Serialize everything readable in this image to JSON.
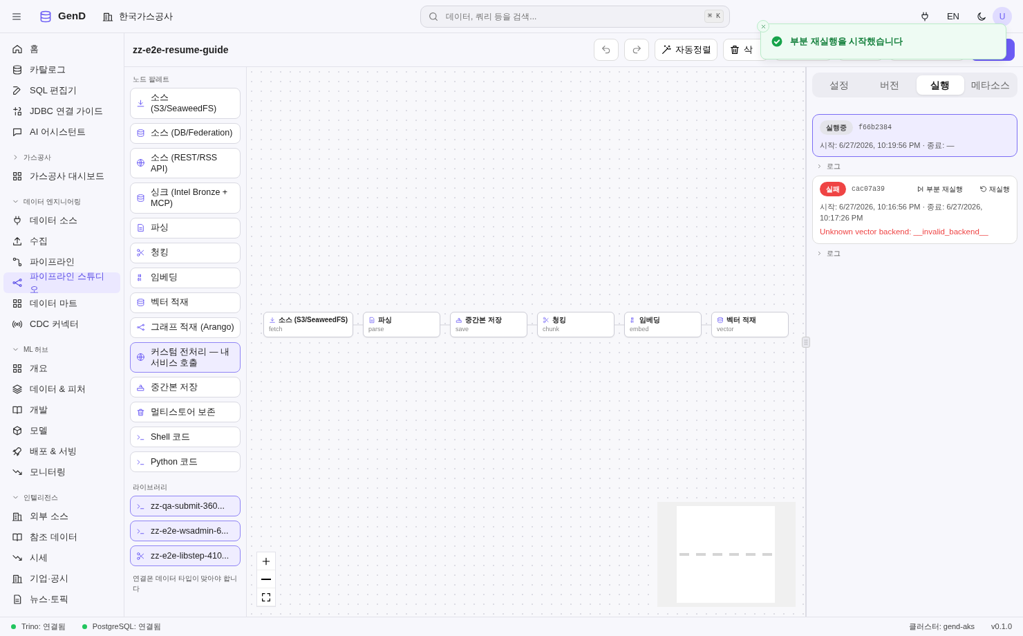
{
  "topbar": {
    "brand": "GenD",
    "org": "한국가스공사",
    "search": {
      "placeholder": "데이터, 쿼리 등을 검색...",
      "shortcut": "⌘ K"
    },
    "language": "EN",
    "avatar": "U"
  },
  "sidebar": {
    "items": [
      {
        "label": "홈",
        "selected": false
      },
      {
        "label": "카탈로그",
        "selected": false
      },
      {
        "label": "SQL 편집기",
        "selected": false
      },
      {
        "label": "JDBC 연결 가이드",
        "selected": false
      },
      {
        "label": "AI 어시스턴트",
        "selected": false
      }
    ],
    "groups": [
      {
        "title": "가스공사",
        "expanded": false,
        "items": [
          {
            "label": "가스공사 대시보드",
            "selected": false
          }
        ]
      },
      {
        "title": "데이터 엔지니어링",
        "expanded": true,
        "items": [
          {
            "label": "데이터 소스",
            "selected": false
          },
          {
            "label": "수집",
            "selected": false
          },
          {
            "label": "파이프라인",
            "selected": false
          },
          {
            "label": "파이프라인 스튜디오",
            "selected": true
          },
          {
            "label": "데이터 마트",
            "selected": false
          },
          {
            "label": "CDC 커넥터",
            "selected": false
          }
        ]
      },
      {
        "title": "ML 허브",
        "expanded": true,
        "items": [
          {
            "label": "개요",
            "selected": false
          },
          {
            "label": "데이터 & 피처",
            "selected": false
          },
          {
            "label": "개발",
            "selected": false
          },
          {
            "label": "모델",
            "selected": false
          },
          {
            "label": "배포 & 서빙",
            "selected": false
          },
          {
            "label": "모니터링",
            "selected": false
          }
        ]
      },
      {
        "title": "인텔리전스",
        "expanded": true,
        "items": [
          {
            "label": "외부 소스",
            "selected": false
          },
          {
            "label": "참조 데이터",
            "selected": false
          },
          {
            "label": "시세",
            "selected": false
          },
          {
            "label": "기업·공시",
            "selected": false
          },
          {
            "label": "뉴스·토픽",
            "selected": false
          }
        ]
      }
    ]
  },
  "page": {
    "title": "zz-e2e-resume-guide",
    "toolbar": {
      "auto_layout": "자동정렬",
      "delete": "삭"
    }
  },
  "palette": {
    "title": "노드 팔레트",
    "items": [
      {
        "label": "소스 (S3/SeaweedFS)",
        "highlighted": false
      },
      {
        "label": "소스 (DB/Federation)",
        "highlighted": false
      },
      {
        "label": "소스 (REST/RSS API)",
        "highlighted": false
      },
      {
        "label": "싱크 (Intel Bronze + MCP)",
        "highlighted": false
      },
      {
        "label": "파싱",
        "highlighted": false
      },
      {
        "label": "청킹",
        "highlighted": false
      },
      {
        "label": "임베딩",
        "highlighted": false
      },
      {
        "label": "벡터 적재",
        "highlighted": false
      },
      {
        "label": "그래프 적재 (Arango)",
        "highlighted": false
      },
      {
        "label": "커스텀 전처리 — 내 서비스 호출",
        "highlighted": true
      },
      {
        "label": "중간본 저장",
        "highlighted": false
      },
      {
        "label": "멀티스토어 보존",
        "highlighted": false
      },
      {
        "label": "Shell 코드",
        "highlighted": false
      },
      {
        "label": "Python 코드",
        "highlighted": false
      }
    ],
    "library_title": "라이브러리",
    "library": [
      {
        "label": "zz-qa-submit-360..."
      },
      {
        "label": "zz-e2e-wsadmin-6..."
      },
      {
        "label": "zz-e2e-libstep-410..."
      }
    ],
    "hint": "연결은 데이터 타입이 맞아야 합니다"
  },
  "canvas": {
    "nodes": [
      {
        "label": "소스 (S3/SeaweedFS)",
        "type": "fetch"
      },
      {
        "label": "파싱",
        "type": "parse"
      },
      {
        "label": "중간본 저장",
        "type": "save"
      },
      {
        "label": "청킹",
        "type": "chunk"
      },
      {
        "label": "임베딩",
        "type": "embed"
      },
      {
        "label": "벡터 적재",
        "type": "vector"
      }
    ]
  },
  "right_panel": {
    "tabs": [
      {
        "label": "설정",
        "selected": false
      },
      {
        "label": "버전",
        "selected": false
      },
      {
        "label": "실행",
        "selected": true
      },
      {
        "label": "메타소스",
        "selected": false
      }
    ],
    "runs": [
      {
        "status": "실행중",
        "kind": "running",
        "id": "f66b2384",
        "selected": true,
        "time": "시작: 6/27/2026, 10:19:56 PM · 종료: —",
        "log": "로그"
      },
      {
        "status": "실패",
        "kind": "failed",
        "id": "cac07a39",
        "selected": false,
        "partial_rerun": "부분 재실행",
        "rerun": "재실행",
        "time": "시작: 6/27/2026, 10:16:56 PM · 종료: 6/27/2026, 10:17:26 PM",
        "error": "Unknown vector backend: __invalid_backend__",
        "log": "로그"
      }
    ]
  },
  "toast": {
    "message": "부분 재실행을 시작했습니다"
  },
  "status_bar": {
    "connections": [
      {
        "label": "Trino: 연결됨",
        "color": "#22c55e"
      },
      {
        "label": "PostgreSQL: 연결됨",
        "color": "#22c55e"
      }
    ],
    "cluster": "클러스터: gend-aks",
    "version": "v0.1.0"
  }
}
